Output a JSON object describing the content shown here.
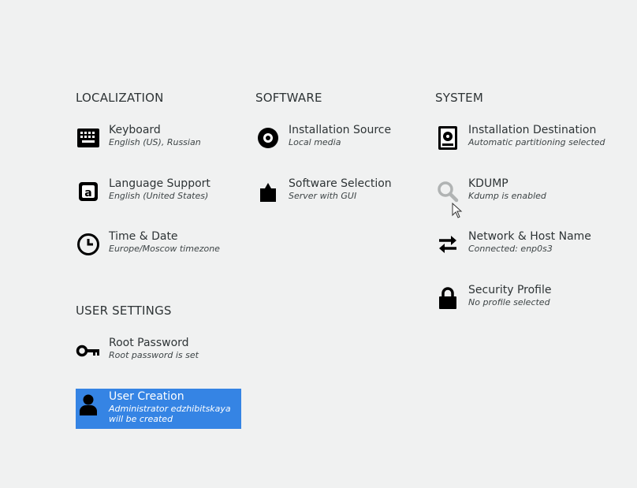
{
  "sections": {
    "localization": "LOCALIZATION",
    "software": "SOFTWARE",
    "system": "SYSTEM",
    "user_settings": "USER SETTINGS"
  },
  "spokes": {
    "keyboard": {
      "title": "Keyboard",
      "status": "English (US), Russian",
      "icon": "keyboard-icon"
    },
    "language": {
      "title": "Language Support",
      "status": "English (United States)",
      "icon": "language-icon"
    },
    "datetime": {
      "title": "Time & Date",
      "status": "Europe/Moscow timezone",
      "icon": "clock-icon"
    },
    "source": {
      "title": "Installation Source",
      "status": "Local media",
      "icon": "disc-icon"
    },
    "selection": {
      "title": "Software Selection",
      "status": "Server with GUI",
      "icon": "package-icon"
    },
    "destination": {
      "title": "Installation Destination",
      "status": "Automatic partitioning selected",
      "icon": "harddisk-icon"
    },
    "kdump": {
      "title": "KDUMP",
      "status": "Kdump is enabled",
      "icon": "magnifier-icon"
    },
    "network": {
      "title": "Network & Host Name",
      "status": "Connected: enp0s3",
      "icon": "network-arrows-icon"
    },
    "security": {
      "title": "Security Profile",
      "status": "No profile selected",
      "icon": "lock-icon"
    },
    "root": {
      "title": "Root Password",
      "status": "Root password is set",
      "icon": "key-icon"
    },
    "user": {
      "title": "User Creation",
      "status_line1": "Administrator edzhibitskaya",
      "status_line2": "will be created",
      "icon": "user-icon",
      "selected": true
    }
  },
  "colors": {
    "background": "#f0f1f1",
    "selected": "#3584e4",
    "text": "#2e3436"
  }
}
